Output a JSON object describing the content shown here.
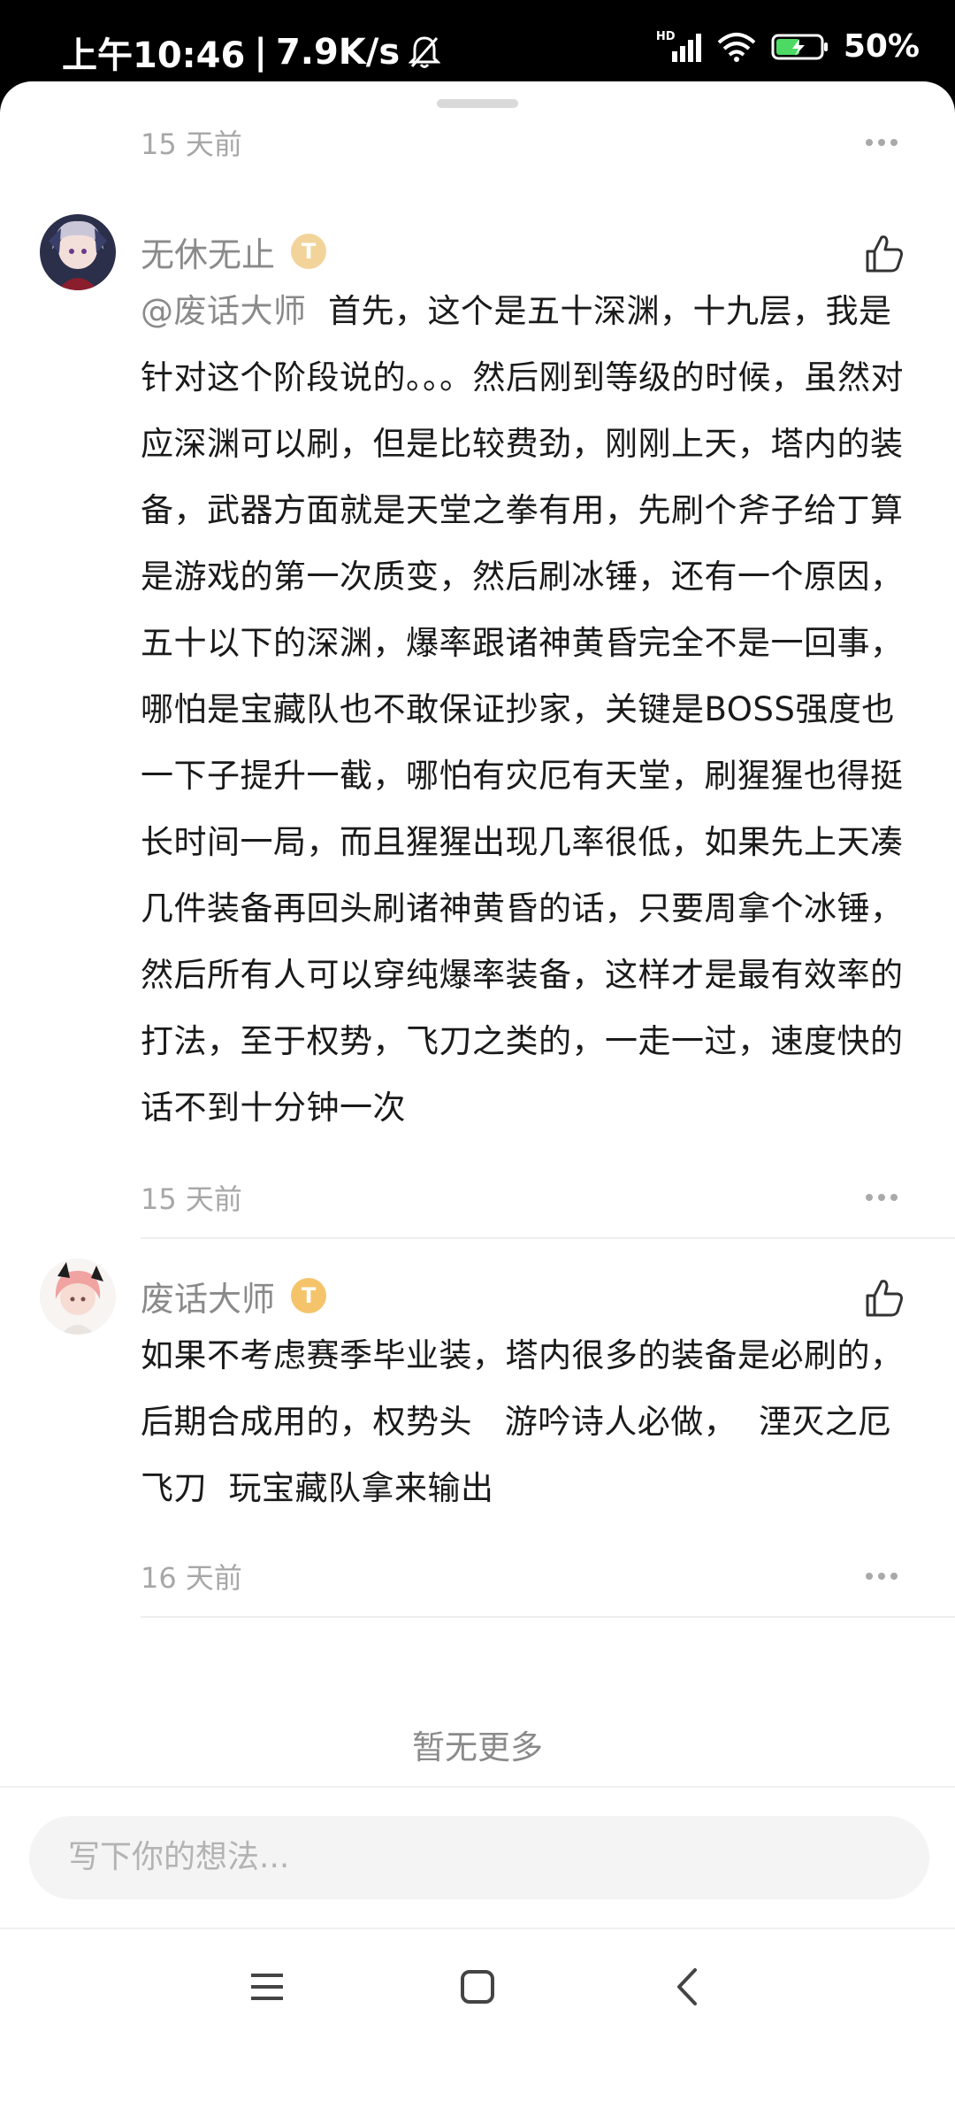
{
  "status_bar": {
    "time": "上午10:46",
    "speed": "7.9K/s",
    "network": "HD",
    "battery": "50%"
  },
  "top_item": {
    "time": "15 天前"
  },
  "comments": [
    {
      "user": "无休无止",
      "badge": "T",
      "mention": "@废话大师",
      "text": "首先，这个是五十深渊，十九层，我是针对这个阶段说的。。。然后刚到等级的时候，虽然对应深渊可以刷，但是比较费劲，刚刚上天，塔内的装备，武器方面就是天堂之拳有用，先刷个斧子给丁算是游戏的第一次质变，然后刷冰锤，还有一个原因，五十以下的深渊，爆率跟诸神黄昏完全不是一回事，哪怕是宝藏队也不敢保证抄家，关键是BOSS强度也一下子提升一截，哪怕有灾厄有天堂，刷猩猩也得挺长时间一局，而且猩猩出现几率很低，如果先上天凑几件装备再回头刷诸神黄昏的话，只要周拿个冰锤，然后所有人可以穿纯爆率装备，这样才是最有效率的打法，至于权势，飞刀之类的，一走一过，速度快的话不到十分钟一次",
      "time": "15 天前"
    },
    {
      "user": "废话大师",
      "badge": "T",
      "mention": "",
      "text": "如果不考虑赛季毕业装，塔内很多的装备是必刷的，后期合成用的，权势头   游吟诗人必做，  湮灭之厄  飞刀  玩宝藏队拿来输出",
      "time": "16 天前"
    }
  ],
  "no_more": "暂无更多",
  "input": {
    "placeholder": "写下你的想法..."
  }
}
